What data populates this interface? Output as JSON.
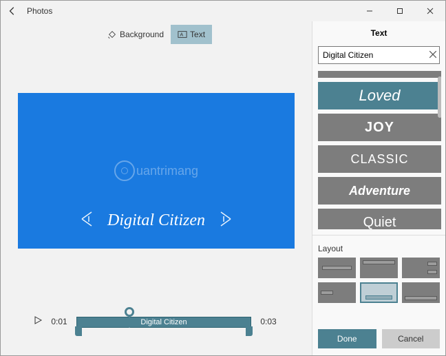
{
  "window": {
    "title": "Photos"
  },
  "toolbar": {
    "background_label": "Background",
    "text_label": "Text"
  },
  "preview": {
    "subtitle": "Digital Citizen",
    "watermark": "uantrimang"
  },
  "timeline": {
    "start": "0:01",
    "end": "0:03",
    "clip_label": "Digital Citizen"
  },
  "panel": {
    "title": "Text",
    "input_value": "Digital Citizen",
    "styles": [
      {
        "label": "Loved",
        "font_class": "f-loved",
        "selected": true
      },
      {
        "label": "JOY",
        "font_class": "f-joy",
        "selected": false
      },
      {
        "label": "CLASSIC",
        "font_class": "f-classic",
        "selected": false
      },
      {
        "label": "Adventure",
        "font_class": "f-adventure",
        "selected": false
      },
      {
        "label": "Quiet",
        "font_class": "f-quiet",
        "selected": false
      }
    ],
    "layout_label": "Layout",
    "done_label": "Done",
    "cancel_label": "Cancel"
  },
  "colors": {
    "accent": "#4c8191",
    "canvas": "#1a7ae0"
  }
}
